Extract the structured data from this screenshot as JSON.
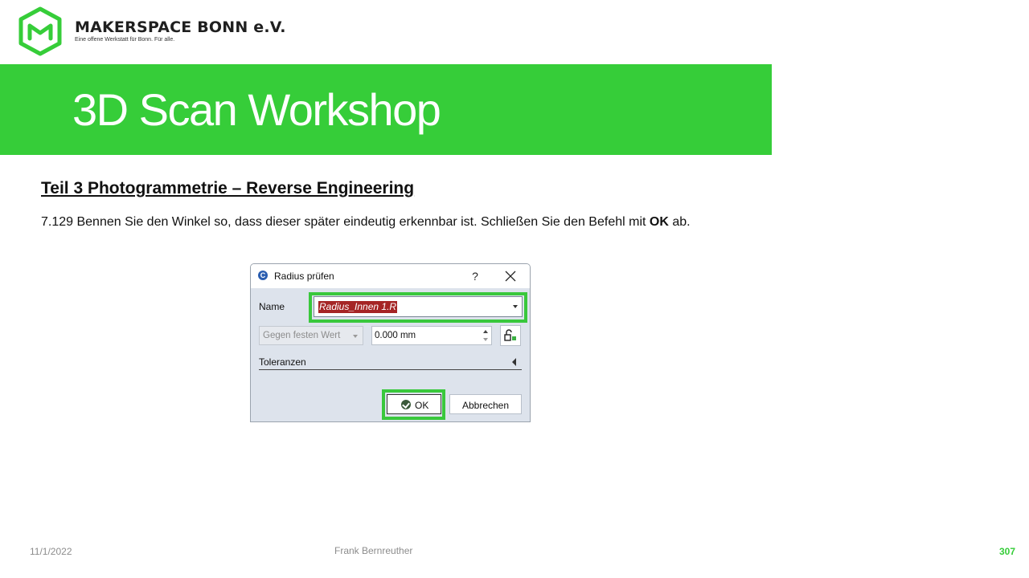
{
  "brand": {
    "name": "MAKERSPACE BONN e.V.",
    "tagline": "Eine offene Werkstatt für Bonn. Für alle.",
    "accent_color": "#36cd39",
    "logo_icon": "hexagon-m-logo"
  },
  "banner": {
    "title": "3D Scan Workshop"
  },
  "slide": {
    "heading": "Teil 3  Photogrammetrie  – Reverse Engineering",
    "instruction_prefix": "7.129 Bennen Sie den  Winkel so, dass dieser später eindeutig erkennbar ist. Schließen Sie den Befehl mit ",
    "instruction_bold": "OK",
    "instruction_suffix": " ab."
  },
  "dialog": {
    "title": "Radius prüfen",
    "help_label": "?",
    "name_label": "Name",
    "name_value": "Radius_Innen 1.R",
    "mode_value": "Gegen festen Wert",
    "value": "0.000 mm",
    "tolerances_label": "Toleranzen",
    "ok_label": "OK",
    "cancel_label": "Abbrechen",
    "highlight_color": "#39c83c"
  },
  "footer": {
    "date": "11/1/2022",
    "author": "Frank Bernreuther",
    "page": "307"
  }
}
